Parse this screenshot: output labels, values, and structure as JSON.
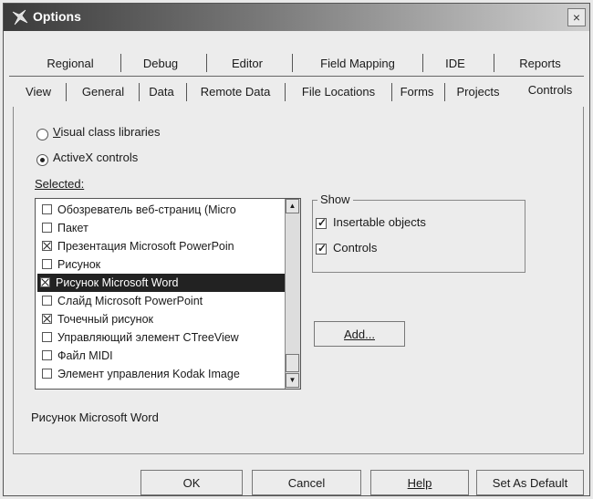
{
  "window": {
    "title": "Options",
    "close_glyph": "×"
  },
  "tabs_top": [
    "Regional",
    "Debug",
    "Editor",
    "Field Mapping",
    "IDE",
    "Reports"
  ],
  "tabs_bottom": [
    "View",
    "General",
    "Data",
    "Remote Data",
    "File Locations",
    "Forms",
    "Projects",
    "Controls"
  ],
  "active_tab": "Controls",
  "radios": [
    {
      "label": "Visual class libraries",
      "checked": false
    },
    {
      "label": "ActiveX controls",
      "checked": true
    }
  ],
  "selected_label": "Selected:",
  "list_items": [
    {
      "label": "Обозреватель веб-страниц (Micro",
      "checked": false,
      "selected": false
    },
    {
      "label": "Пакет",
      "checked": false,
      "selected": false
    },
    {
      "label": "Презентация Microsoft PowerPoin",
      "checked": true,
      "selected": false
    },
    {
      "label": "Рисунок",
      "checked": false,
      "selected": false
    },
    {
      "label": "Рисунок Microsoft Word",
      "checked": true,
      "selected": true
    },
    {
      "label": "Слайд Microsoft PowerPoint",
      "checked": false,
      "selected": false
    },
    {
      "label": "Точечный рисунок",
      "checked": true,
      "selected": false
    },
    {
      "label": "Управляющий элемент CTreeView",
      "checked": false,
      "selected": false
    },
    {
      "label": "Файл MIDI",
      "checked": false,
      "selected": false
    },
    {
      "label": "Элемент управления Kodak Image",
      "checked": false,
      "selected": false
    }
  ],
  "show_group": {
    "title": "Show",
    "options": [
      {
        "label": "Insertable objects",
        "checked": true
      },
      {
        "label": "Controls",
        "checked": true
      }
    ]
  },
  "add_button": "Add...",
  "status_text": "Рисунок Microsoft Word",
  "buttons": {
    "ok": "OK",
    "cancel": "Cancel",
    "help": "Help",
    "default": "Set As Default"
  }
}
